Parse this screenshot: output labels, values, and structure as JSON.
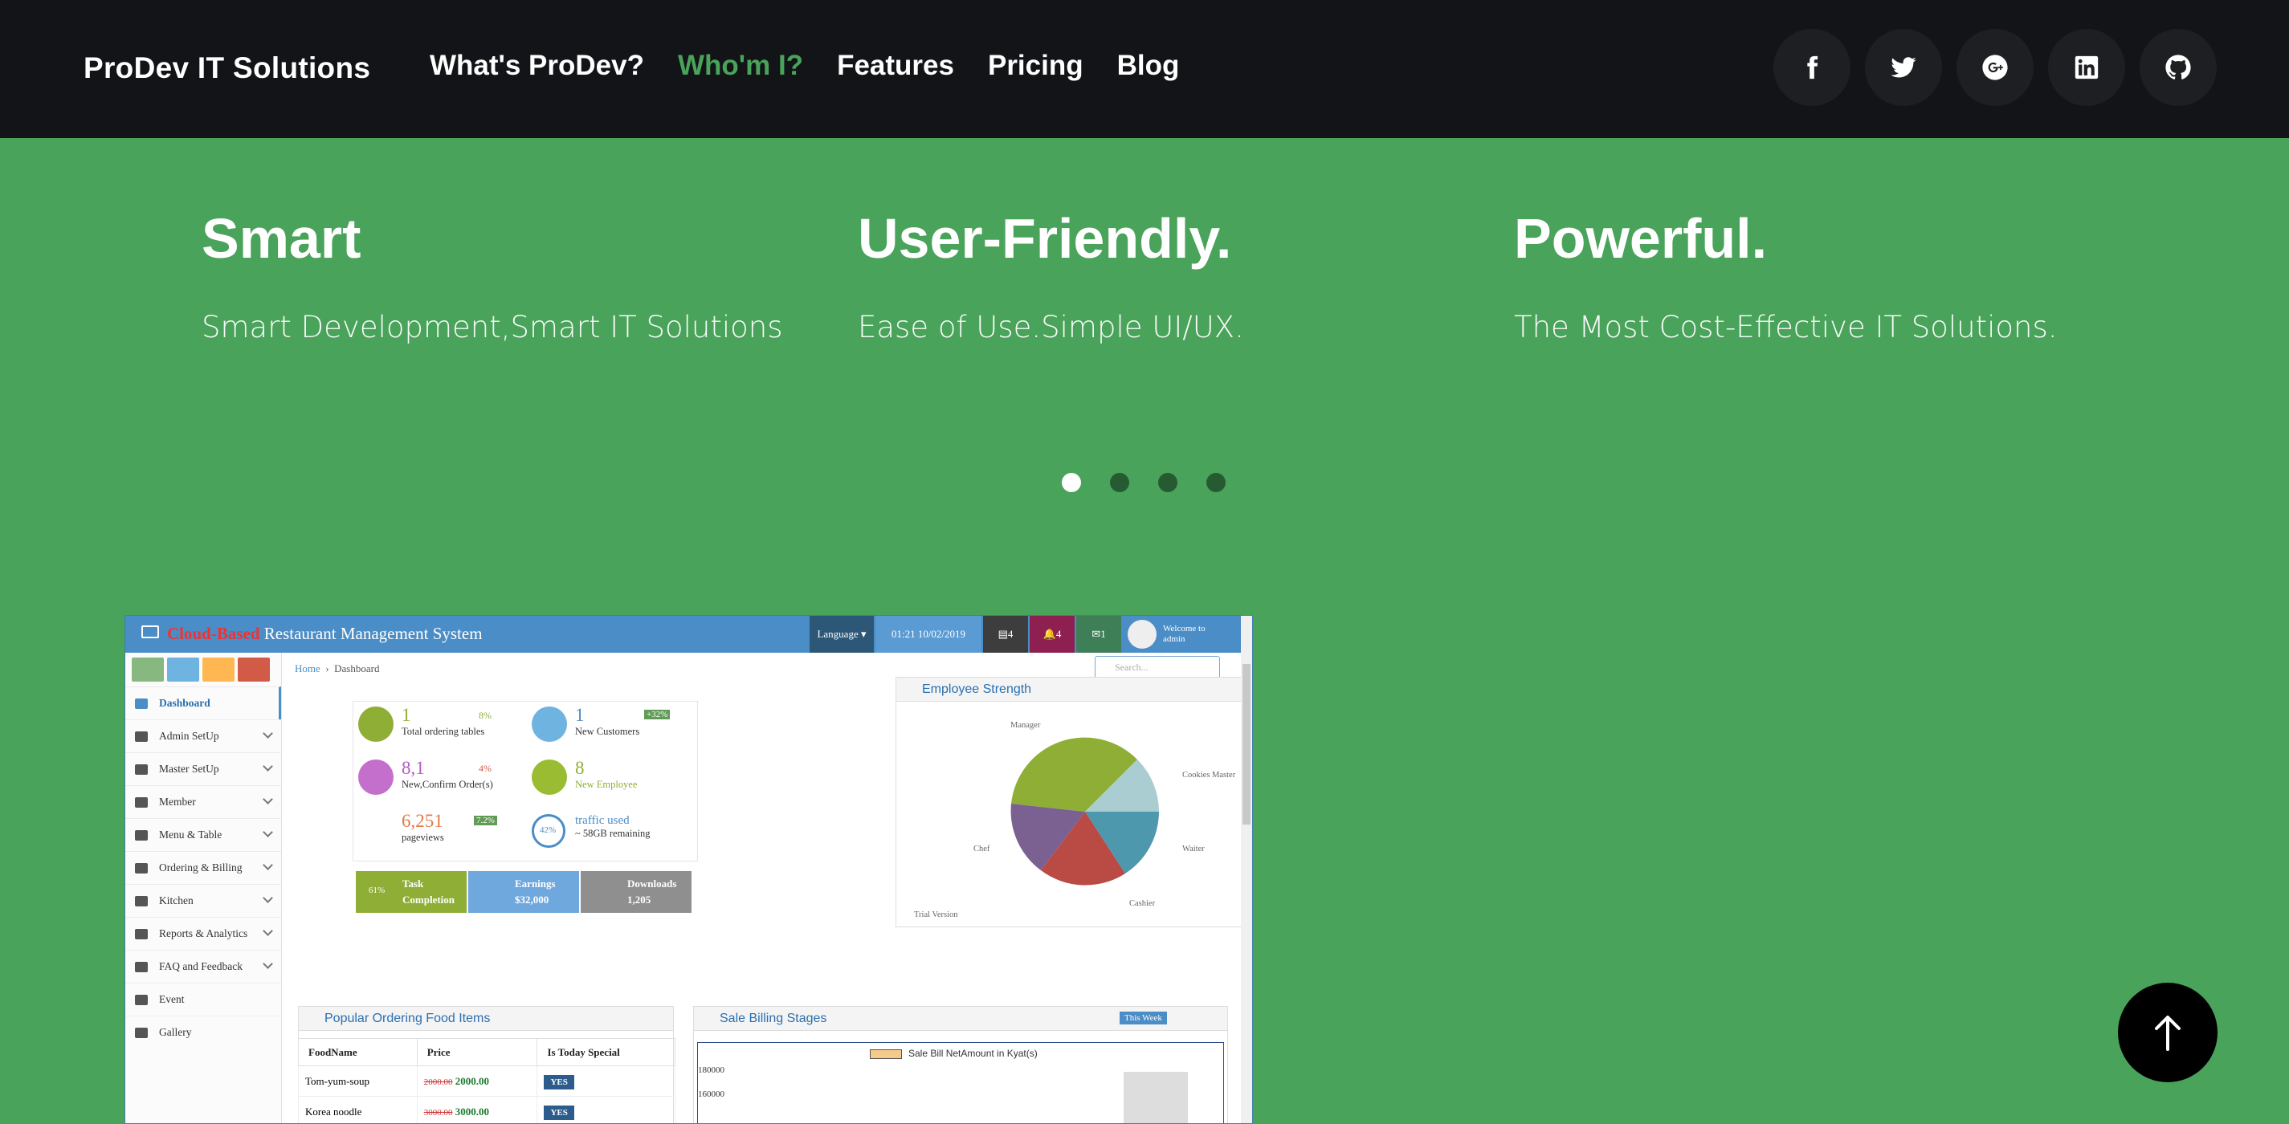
{
  "brand": "ProDev IT Solutions",
  "nav": [
    {
      "label": "What's ProDev?",
      "active": false
    },
    {
      "label": "Who'm I?",
      "active": true
    },
    {
      "label": "Features",
      "active": false
    },
    {
      "label": "Pricing",
      "active": false
    },
    {
      "label": "Blog",
      "active": false
    }
  ],
  "social_icons": [
    "facebook-icon",
    "twitter-icon",
    "google-plus-icon",
    "linkedin-icon",
    "github-icon"
  ],
  "features": [
    {
      "title": "Smart",
      "text": "Smart Development,Smart IT Solutions"
    },
    {
      "title": "User-Friendly.",
      "text": "Ease of Use.Simple UI/UX."
    },
    {
      "title": "Powerful.",
      "text": "The Most Cost-Effective IT Solutions."
    }
  ],
  "carousel": {
    "count": 4,
    "active_index": 0
  },
  "screenshot": {
    "title_red": "Cloud-Based",
    "title_rest": " Restaurant Management System",
    "language": "Language",
    "datetime": "01:21 10/02/2019",
    "badges": [
      "4",
      "4",
      "1"
    ],
    "welcome": "Welcome to",
    "user": "admin",
    "search_placeholder": "Search...",
    "breadcrumb": {
      "home": "Home",
      "current": "Dashboard"
    },
    "menu": [
      {
        "label": "Dashboard",
        "active": true
      },
      {
        "label": "Admin SetUp"
      },
      {
        "label": "Master SetUp"
      },
      {
        "label": "Member"
      },
      {
        "label": "Menu & Table"
      },
      {
        "label": "Ordering & Billing"
      },
      {
        "label": "Kitchen"
      },
      {
        "label": "Reports & Analytics"
      },
      {
        "label": "FAQ and Feedback"
      },
      {
        "label": "Event"
      },
      {
        "label": "Gallery"
      }
    ],
    "stats": [
      {
        "value": "1",
        "label": "Total ordering tables",
        "delta": "8%"
      },
      {
        "value": "1",
        "label": "New Customers",
        "delta": "+32%"
      },
      {
        "value": "8,1",
        "label": "New,Confirm Order(s)",
        "delta": "4%"
      },
      {
        "value": "8",
        "label": "New Employee"
      },
      {
        "value": "6,251",
        "label": "pageviews",
        "delta": "7.2%"
      },
      {
        "value": "traffic used",
        "label": "~ 58GB remaining",
        "gauge": "42%"
      }
    ],
    "tiles": [
      {
        "pct": "61%",
        "line1": "Task",
        "line2": "Completion"
      },
      {
        "line1": "Earnings",
        "line2": "$32,000"
      },
      {
        "line1": "Downloads",
        "line2": "1,205"
      }
    ],
    "employee_panel": {
      "title": "Employee Strength",
      "slices": [
        {
          "label": "Manager",
          "color": "#8fae36"
        },
        {
          "label": "Cookies Master",
          "color": "#a9cdd0"
        },
        {
          "label": "Waiter",
          "color": "#4e98ae"
        },
        {
          "label": "Cashier",
          "color": "#b94a44"
        },
        {
          "label": "Chef",
          "color": "#7a6191"
        }
      ],
      "note": "Trial Version"
    },
    "food_panel": {
      "title": "Popular Ordering Food Items",
      "headers": [
        "FoodName",
        "Price",
        "Is Today Special"
      ],
      "rows": [
        {
          "name": "Tom-yum-soup",
          "old": "2000.00",
          "price": "2000.00",
          "special": "YES"
        },
        {
          "name": "Korea noodle",
          "old": "3000.00",
          "price": "3000.00",
          "special": "YES"
        }
      ]
    },
    "billing_panel": {
      "title": "Sale Billing Stages",
      "range": "This Week",
      "legend": "Sale Bill NetAmount in Kyat(s)",
      "y_ticks": [
        "180000",
        "160000"
      ]
    }
  },
  "to_top_icon": "arrow-up-icon"
}
